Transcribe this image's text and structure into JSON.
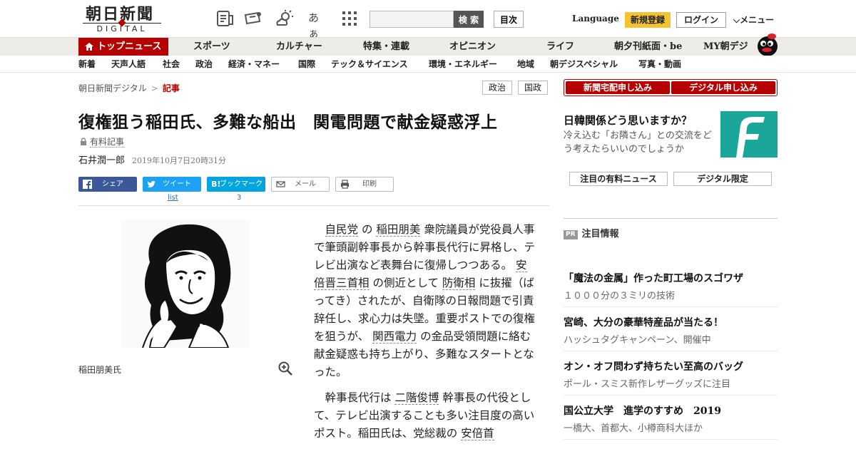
{
  "header": {
    "logo_main": "朝日新聞",
    "logo_sub": "DIGITAL",
    "ja_icon_text": "あぁ",
    "search_placeholder": "",
    "search_button": "検 索",
    "toc_button": "目次",
    "language": "Language",
    "signup": "新規登録",
    "login": "ログイン",
    "menu": "メニュー"
  },
  "nav1": {
    "home": "トップニュース",
    "items": [
      "スポーツ",
      "カルチャー",
      "特集・連載",
      "オピニオン",
      "ライフ",
      "朝夕刊紙面・be",
      "MY朝デジ"
    ]
  },
  "nav2": {
    "items": [
      "新着",
      "天声人語",
      "社会",
      "政治",
      "経済・マネー",
      "国際",
      "テック＆サイエンス",
      "環境・エネルギー",
      "地域",
      "朝デジスペシャル",
      "写真・動画"
    ]
  },
  "breadcrumb": {
    "root": "朝日新聞デジタル",
    "sep": ">",
    "current": "記事"
  },
  "tags": [
    "政治",
    "国政"
  ],
  "article": {
    "title": "復権狙う稲田氏、多難な船出　関電問題で献金疑惑浮上",
    "paid_label": "有料記事",
    "author": "石井潤一郎",
    "date": "2019年10月7日20時31分",
    "photo_caption": "稲田朋美氏",
    "share": {
      "facebook": "シェア",
      "twitter": "ツイート",
      "hatena": "ブックマーク",
      "mail": "メール",
      "print": "印刷",
      "twitter_count": "list",
      "hatena_count": "3"
    },
    "p1": {
      "l1": "自民党",
      "t1": " の ",
      "l2": "稲田朋美",
      "t2": " 衆院議員が党役員人事で筆頭副幹事長から幹事長代行に昇格し、テレビ出演など表舞台に復帰しつつある。 ",
      "l3": "安倍晋三首相",
      "t3": " の側近として ",
      "l4": "防衛相",
      "t4": " に抜擢（ばってき）されたが、自衛隊の日報問題で引責辞任し、求心力は失墜。重要ポストでの復権を狙うが、 ",
      "l5": "関西電力",
      "t5": " の金品受領問題に絡む献金疑惑も持ち上がり、多難なスタートとなった。"
    },
    "p2": {
      "t1": "幹事長代行は ",
      "l1": "二階俊博",
      "t2": " 幹事長の代役として、テレビ出演することも多い注目度の高いポスト。稲田氏は、党総裁の ",
      "l2": "安倍首"
    }
  },
  "sidebar": {
    "subscribe_paper": "新聞宅配申し込み",
    "subscribe_digital": "デジタル申し込み",
    "promo_title": "日韓関係どう思いますか？",
    "promo_sub": "冷え込む「お隣さん」との交流をどう考えたらいいのでしょうか",
    "pill_paid": "注目の有料ニュース",
    "pill_digital": "デジタル限定",
    "pr_badge": "PR",
    "pr_title": "注目情報",
    "ads": [
      {
        "h": "「魔法の金属」作った町工場のスゴワザ",
        "s": "１０００分の３ミリの技術"
      },
      {
        "h": "宮崎、大分の豪華特産品が当たる！",
        "s": "ハッシュタグキャンペーン、開催中"
      },
      {
        "h": "オン・オフ問わず持ちたい至高のバッグ",
        "s": "ポール・スミス新作レザーグッズに注目"
      },
      {
        "h": "国公立大学　進学のすすめ　2019",
        "s": "一橋大、首都大、小樽商科大ほか"
      }
    ]
  },
  "colors": {
    "brand_red": "#b60000",
    "signup_yellow": "#f3c332",
    "facebook": "#3b5998",
    "twitter": "#1da1f2",
    "hatena": "#00a4de",
    "promo_teal": "#1aa79a"
  }
}
